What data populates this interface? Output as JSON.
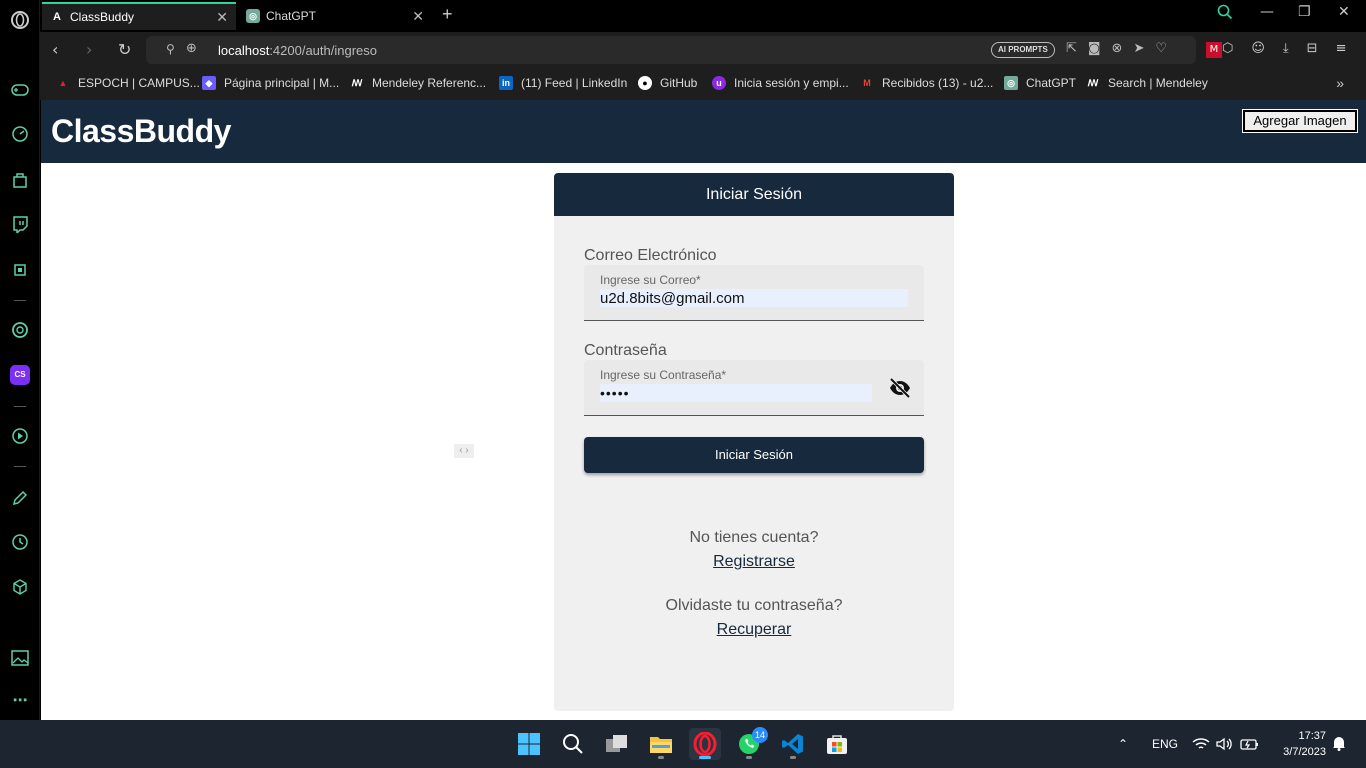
{
  "browser": {
    "tabs": [
      {
        "title": "ClassBuddy",
        "active": true
      },
      {
        "title": "ChatGPT",
        "active": false
      }
    ],
    "url": {
      "host": "localhost",
      "path": ":4200/auth/ingreso"
    },
    "ai_prompts_label": "AI PROMPTS",
    "bookmarks": [
      "ESPOCH | CAMPUS...",
      "Página principal | M...",
      "Mendeley Referenc...",
      "(11) Feed | LinkedIn",
      "GitHub",
      "Inicia sesión y empi...",
      "Recibidos (13) - u2...",
      "ChatGPT",
      "Search | Mendeley"
    ]
  },
  "app": {
    "brand": "ClassBuddy",
    "add_image_label": "Agregar Imagen"
  },
  "login": {
    "title": "Iniciar Sesión",
    "email_section_label": "Correo Electrónico",
    "email_float_label": "Ingrese su Correo*",
    "email_value": "u2d.8bits@gmail.com",
    "password_section_label": "Contraseña",
    "password_float_label": "Ingrese su Contraseña*",
    "password_value": "•••••",
    "submit_label": "Iniciar Sesión",
    "no_account_text": "No tienes cuenta?",
    "register_link": "Registrarse",
    "forgot_text": "Olvidaste tu contraseña?",
    "recover_link": "Recuperar"
  },
  "taskbar": {
    "language": "ENG",
    "time": "17:37",
    "date": "3/7/2023",
    "whatsapp_badge": "14"
  },
  "colors": {
    "brand_navy": "#172a3d",
    "opera_accent": "#2bd6a0",
    "card_bg": "#f0f0f0"
  }
}
